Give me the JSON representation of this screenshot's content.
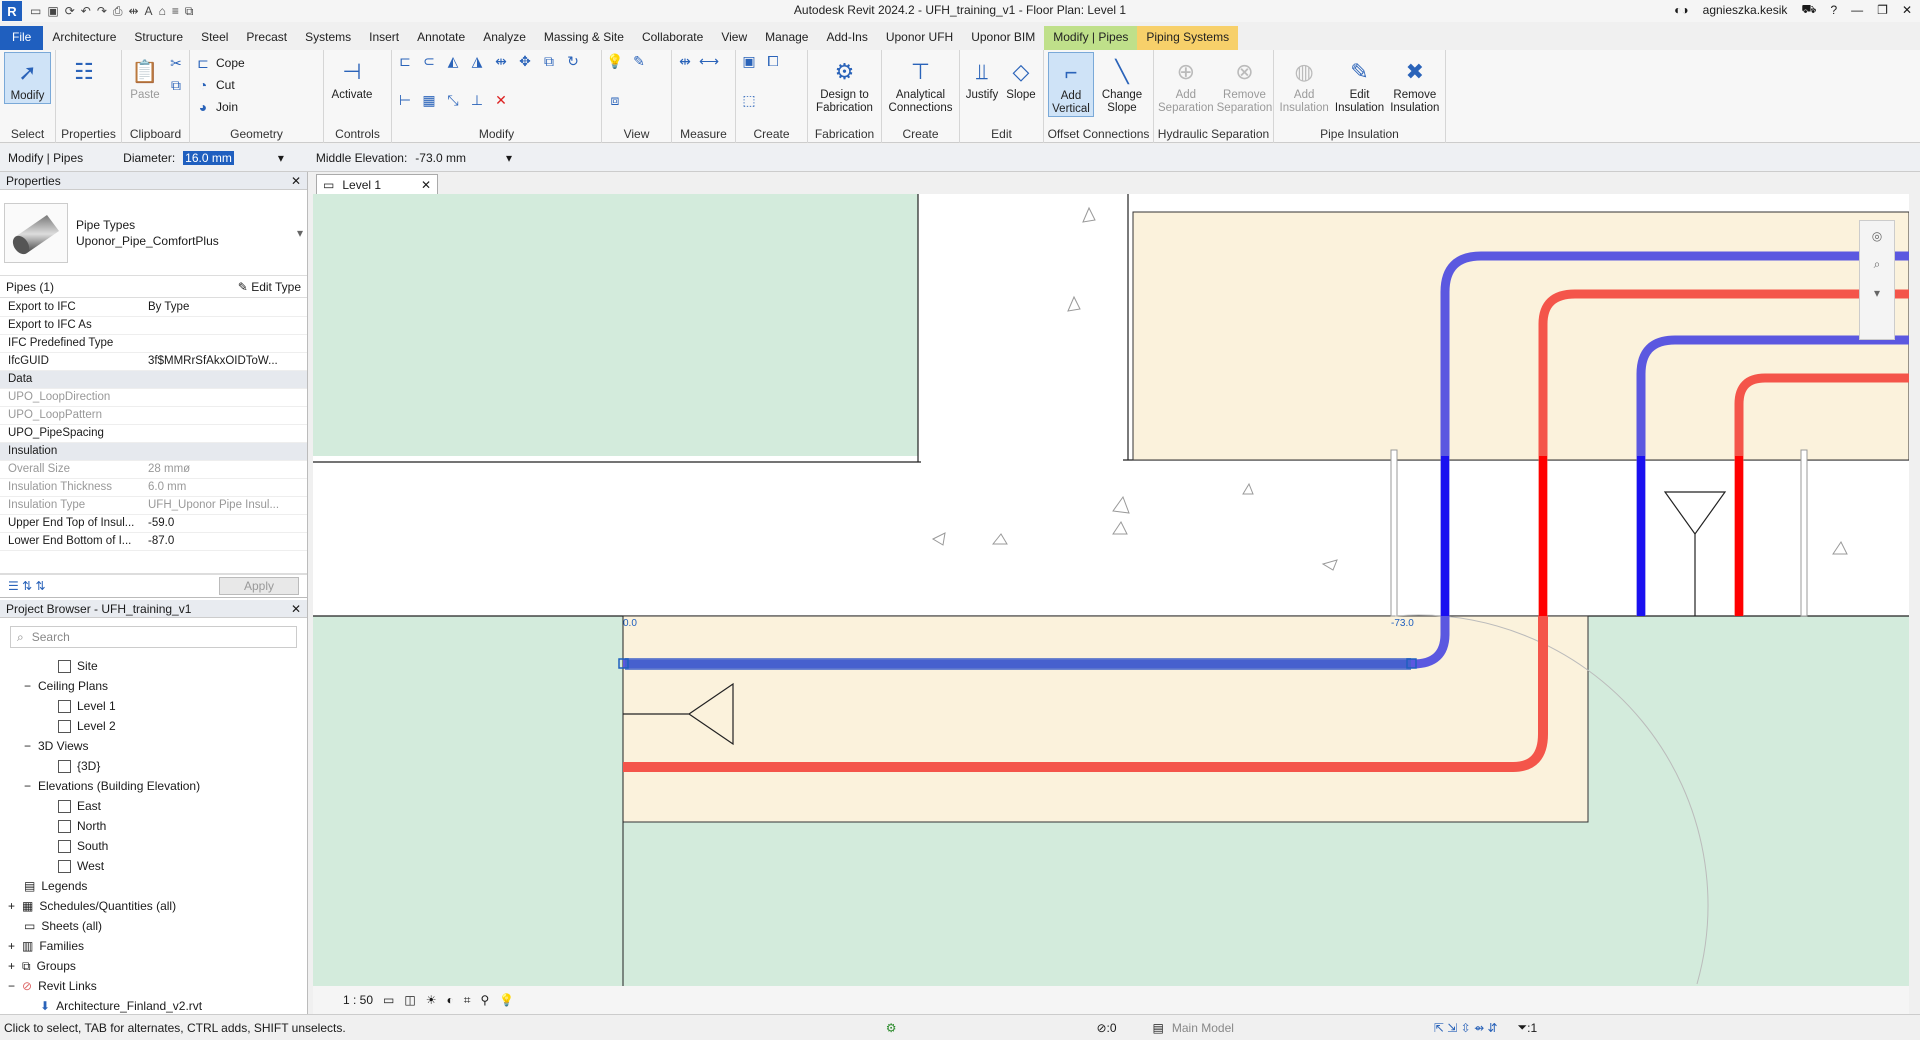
{
  "titlebar": {
    "title": "Autodesk Revit 2024.2 - UFH_training_v1 - Floor Plan: Level 1",
    "user": "agnieszka.kesik"
  },
  "menu": {
    "tabs": [
      "File",
      "Architecture",
      "Structure",
      "Steel",
      "Precast",
      "Systems",
      "Insert",
      "Annotate",
      "Analyze",
      "Massing & Site",
      "Collaborate",
      "View",
      "Manage",
      "Add-Ins",
      "Uponor UFH",
      "Uponor BIM",
      "Modify | Pipes",
      "Piping Systems"
    ]
  },
  "ribbon": {
    "select": {
      "modify": "Modify",
      "title": "Select"
    },
    "properties": {
      "label": "Properties"
    },
    "clipboard": {
      "paste": "Paste",
      "title": "Clipboard"
    },
    "geometry": {
      "cope": "Cope",
      "cut": "Cut",
      "join": "Join",
      "title": "Geometry"
    },
    "controls": {
      "activate": "Activate",
      "title": "Controls"
    },
    "modify": {
      "title": "Modify"
    },
    "view": {
      "title": "View"
    },
    "measure": {
      "title": "Measure"
    },
    "create": {
      "title": "Create"
    },
    "fabrication": {
      "btn": "Design to Fabrication",
      "title": "Fabrication"
    },
    "create2": {
      "btn": "Analytical Connections",
      "title": "Create"
    },
    "edit": {
      "justify": "Justify",
      "slope": "Slope",
      "title": "Edit"
    },
    "offset": {
      "addv": "Add Vertical",
      "chgs": "Change Slope",
      "title": "Offset Connections"
    },
    "hydraulic": {
      "adds": "Add Separation",
      "rems": "Remove Separation",
      "title": "Hydraulic Separation"
    },
    "insulation": {
      "addi": "Add Insulation",
      "edi": "Edit Insulation",
      "remi": "Remove Insulation",
      "title": "Pipe Insulation"
    }
  },
  "options": {
    "context": "Modify | Pipes",
    "diameter_label": "Diameter:",
    "diameter_value": "16.0 mm",
    "elev_label": "Middle Elevation:",
    "elev_value": "-73.0 mm"
  },
  "properties": {
    "title": "Properties",
    "type_family": "Pipe Types",
    "type_name": "Uponor_Pipe_ComfortPlus",
    "instance": "Pipes (1)",
    "edit_type": "Edit Type",
    "rows": [
      {
        "k": "Export to IFC",
        "v": "By Type"
      },
      {
        "k": "Export to IFC As",
        "v": ""
      },
      {
        "k": "IFC Predefined Type",
        "v": ""
      },
      {
        "k": "IfcGUID",
        "v": "3f$MMRrSfAkxOIDToW..."
      }
    ],
    "data_group": "Data",
    "data_rows": [
      {
        "k": "UPO_LoopDirection",
        "v": ""
      },
      {
        "k": "UPO_LoopPattern",
        "v": ""
      },
      {
        "k": "UPO_PipeSpacing",
        "v": ""
      }
    ],
    "ins_group": "Insulation",
    "ins_rows": [
      {
        "k": "Overall Size",
        "v": "28 mmø"
      },
      {
        "k": "Insulation Thickness",
        "v": "6.0 mm"
      },
      {
        "k": "Insulation Type",
        "v": "UFH_Uponor Pipe Insul..."
      },
      {
        "k": "Upper End Top of Insul...",
        "v": "-59.0"
      },
      {
        "k": "Lower End Bottom of I...",
        "v": "-87.0"
      }
    ],
    "apply": "Apply"
  },
  "browser": {
    "title": "Project Browser - UFH_training_v1",
    "search_placeholder": "Search",
    "items": [
      "Site",
      "Ceiling Plans",
      "Level 1",
      "Level 2",
      "3D Views",
      "{3D}",
      "Elevations (Building Elevation)",
      "East",
      "North",
      "South",
      "West",
      "Legends",
      "Schedules/Quantities (all)",
      "Sheets (all)",
      "Families",
      "Groups",
      "Revit Links",
      "Architecture_Finland_v2.rvt"
    ]
  },
  "document": {
    "tab": "Level 1",
    "scale": "1 : 50",
    "tag_left": "0.0",
    "tag_right": "-73.0"
  },
  "status": {
    "hint": "Click to select, TAB for alternates, CTRL adds, SHIFT unselects.",
    "count": ":0",
    "model": "Main Model",
    "filter": ":1"
  },
  "colors": {
    "supply": "#f4554a",
    "return": "#5b58e0",
    "floor": "#fbf2dc",
    "room": "#d3ebdc",
    "selected": "#3f63c8"
  }
}
